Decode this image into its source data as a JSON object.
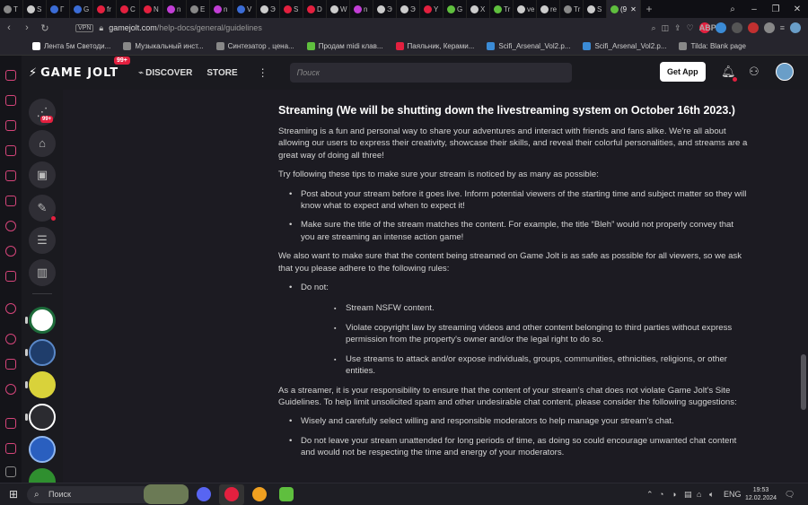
{
  "browser": {
    "tabs": [
      {
        "label": "Т",
        "color": "#888888"
      },
      {
        "label": "S",
        "color": "#cccccc"
      },
      {
        "label": "Г",
        "color": "#3b6cd6"
      },
      {
        "label": "G",
        "color": "#3b6cd6"
      },
      {
        "label": "fr",
        "color": "#e3203f"
      },
      {
        "label": "C",
        "color": "#e3203f"
      },
      {
        "label": "N",
        "color": "#e3203f"
      },
      {
        "label": "n",
        "color": "#c23ed6"
      },
      {
        "label": "E",
        "color": "#888888"
      },
      {
        "label": "n",
        "color": "#c23ed6"
      },
      {
        "label": "V",
        "color": "#3b6cd6"
      },
      {
        "label": "Э",
        "color": "#cccccc"
      },
      {
        "label": "S",
        "color": "#e3203f"
      },
      {
        "label": "D",
        "color": "#e3203f"
      },
      {
        "label": "W",
        "color": "#cccccc"
      },
      {
        "label": "n",
        "color": "#c23ed6"
      },
      {
        "label": "Э",
        "color": "#cccccc"
      },
      {
        "label": "Э",
        "color": "#cccccc"
      },
      {
        "label": "Y",
        "color": "#e3203f"
      },
      {
        "label": "G",
        "color": "#5fbf3e"
      },
      {
        "label": "X",
        "color": "#cccccc"
      },
      {
        "label": "Tr",
        "color": "#5fbf3e"
      },
      {
        "label": "ve",
        "color": "#cccccc"
      },
      {
        "label": "re",
        "color": "#cccccc"
      },
      {
        "label": "Tr",
        "color": "#888888"
      },
      {
        "label": "S",
        "color": "#cccccc"
      }
    ],
    "active_tab": {
      "label": "(9",
      "color": "#5fbf3e"
    },
    "new_tab": "+",
    "vpn_label": "VPN",
    "url_host": "gamejolt.com",
    "url_path": "/help-docs/general/guidelines",
    "bookmarks": [
      {
        "label": "Лента 5м Светоди...",
        "color": "#ffffff"
      },
      {
        "label": "Музыкальный инст...",
        "color": "#888888"
      },
      {
        "label": "Синтезатор , цена...",
        "color": "#888888"
      },
      {
        "label": "Продам midi клав...",
        "color": "#5fbf3e"
      },
      {
        "label": "Паяльник, Керами...",
        "color": "#e3203f"
      },
      {
        "label": "Scifi_Arsenal_Vol2.p...",
        "color": "#3b8bd6"
      },
      {
        "label": "Scifi_Arsenal_Vol2.p...",
        "color": "#3b8bd6"
      },
      {
        "label": "Tilda: Blank page",
        "color": "#888888"
      }
    ]
  },
  "header": {
    "logo": "GAME JOLT",
    "logo_badge": "99+",
    "discover": "DISCOVER",
    "store": "STORE",
    "search_placeholder": "Поиск",
    "get_app": "Get App"
  },
  "shell": {
    "activity_badge": "99+"
  },
  "article": {
    "heading": "Streaming  (We will be shutting down the livestreaming system on October 16th 2023.)",
    "intro": "Streaming is a fun and personal way to share your adventures and interact with friends and fans alike. We're all about allowing our users to express their creativity, showcase their skills, and reveal their colorful personalities, and streams are a great way of doing all three!",
    "tips_lead": "Try following these tips to make sure your stream is noticed by as many as possible:",
    "tips": [
      "Post about your stream before it goes live. Inform potential viewers of the starting time and subject matter so they will know what to expect and when to expect it!",
      "Make sure the title of the stream matches the content. For example, the title “Bleh” would not properly convey that you are streaming an intense action game!"
    ],
    "rules_lead": "We also want to make sure that the content being streamed on Game Jolt is as safe as possible for all viewers, so we ask that you please adhere to the following rules:",
    "do_not": "Do not:",
    "rules": [
      "Stream NSFW content.",
      "Violate copyright law by streaming videos and other content belonging to third parties without express permission from the property's owner and/or the legal right to do so.",
      "Use streams to attack and/or expose individuals, groups, communities, ethnicities, religions, or other entities."
    ],
    "streamer_lead": "As a streamer, it is your responsibility to ensure that the content of your stream's chat does not violate Game Jolt's Site Guidelines. To help limit unsolicited spam and other undesirable chat content, please consider the following suggestions:",
    "suggestions": [
      "Wisely and carefully select willing and responsible moderators to help manage your stream's chat.",
      "Do not leave your stream unattended for long periods of time, as doing so could encourage unwanted chat content and would not be respecting the time and energy of your moderators."
    ]
  },
  "taskbar": {
    "search": "Поиск",
    "lang": "ENG",
    "time": "19:53",
    "date": "12.02.2024"
  },
  "colors": {
    "accent": "#e3203f",
    "background": "#1c1b22",
    "text": "#d4d4d4"
  }
}
